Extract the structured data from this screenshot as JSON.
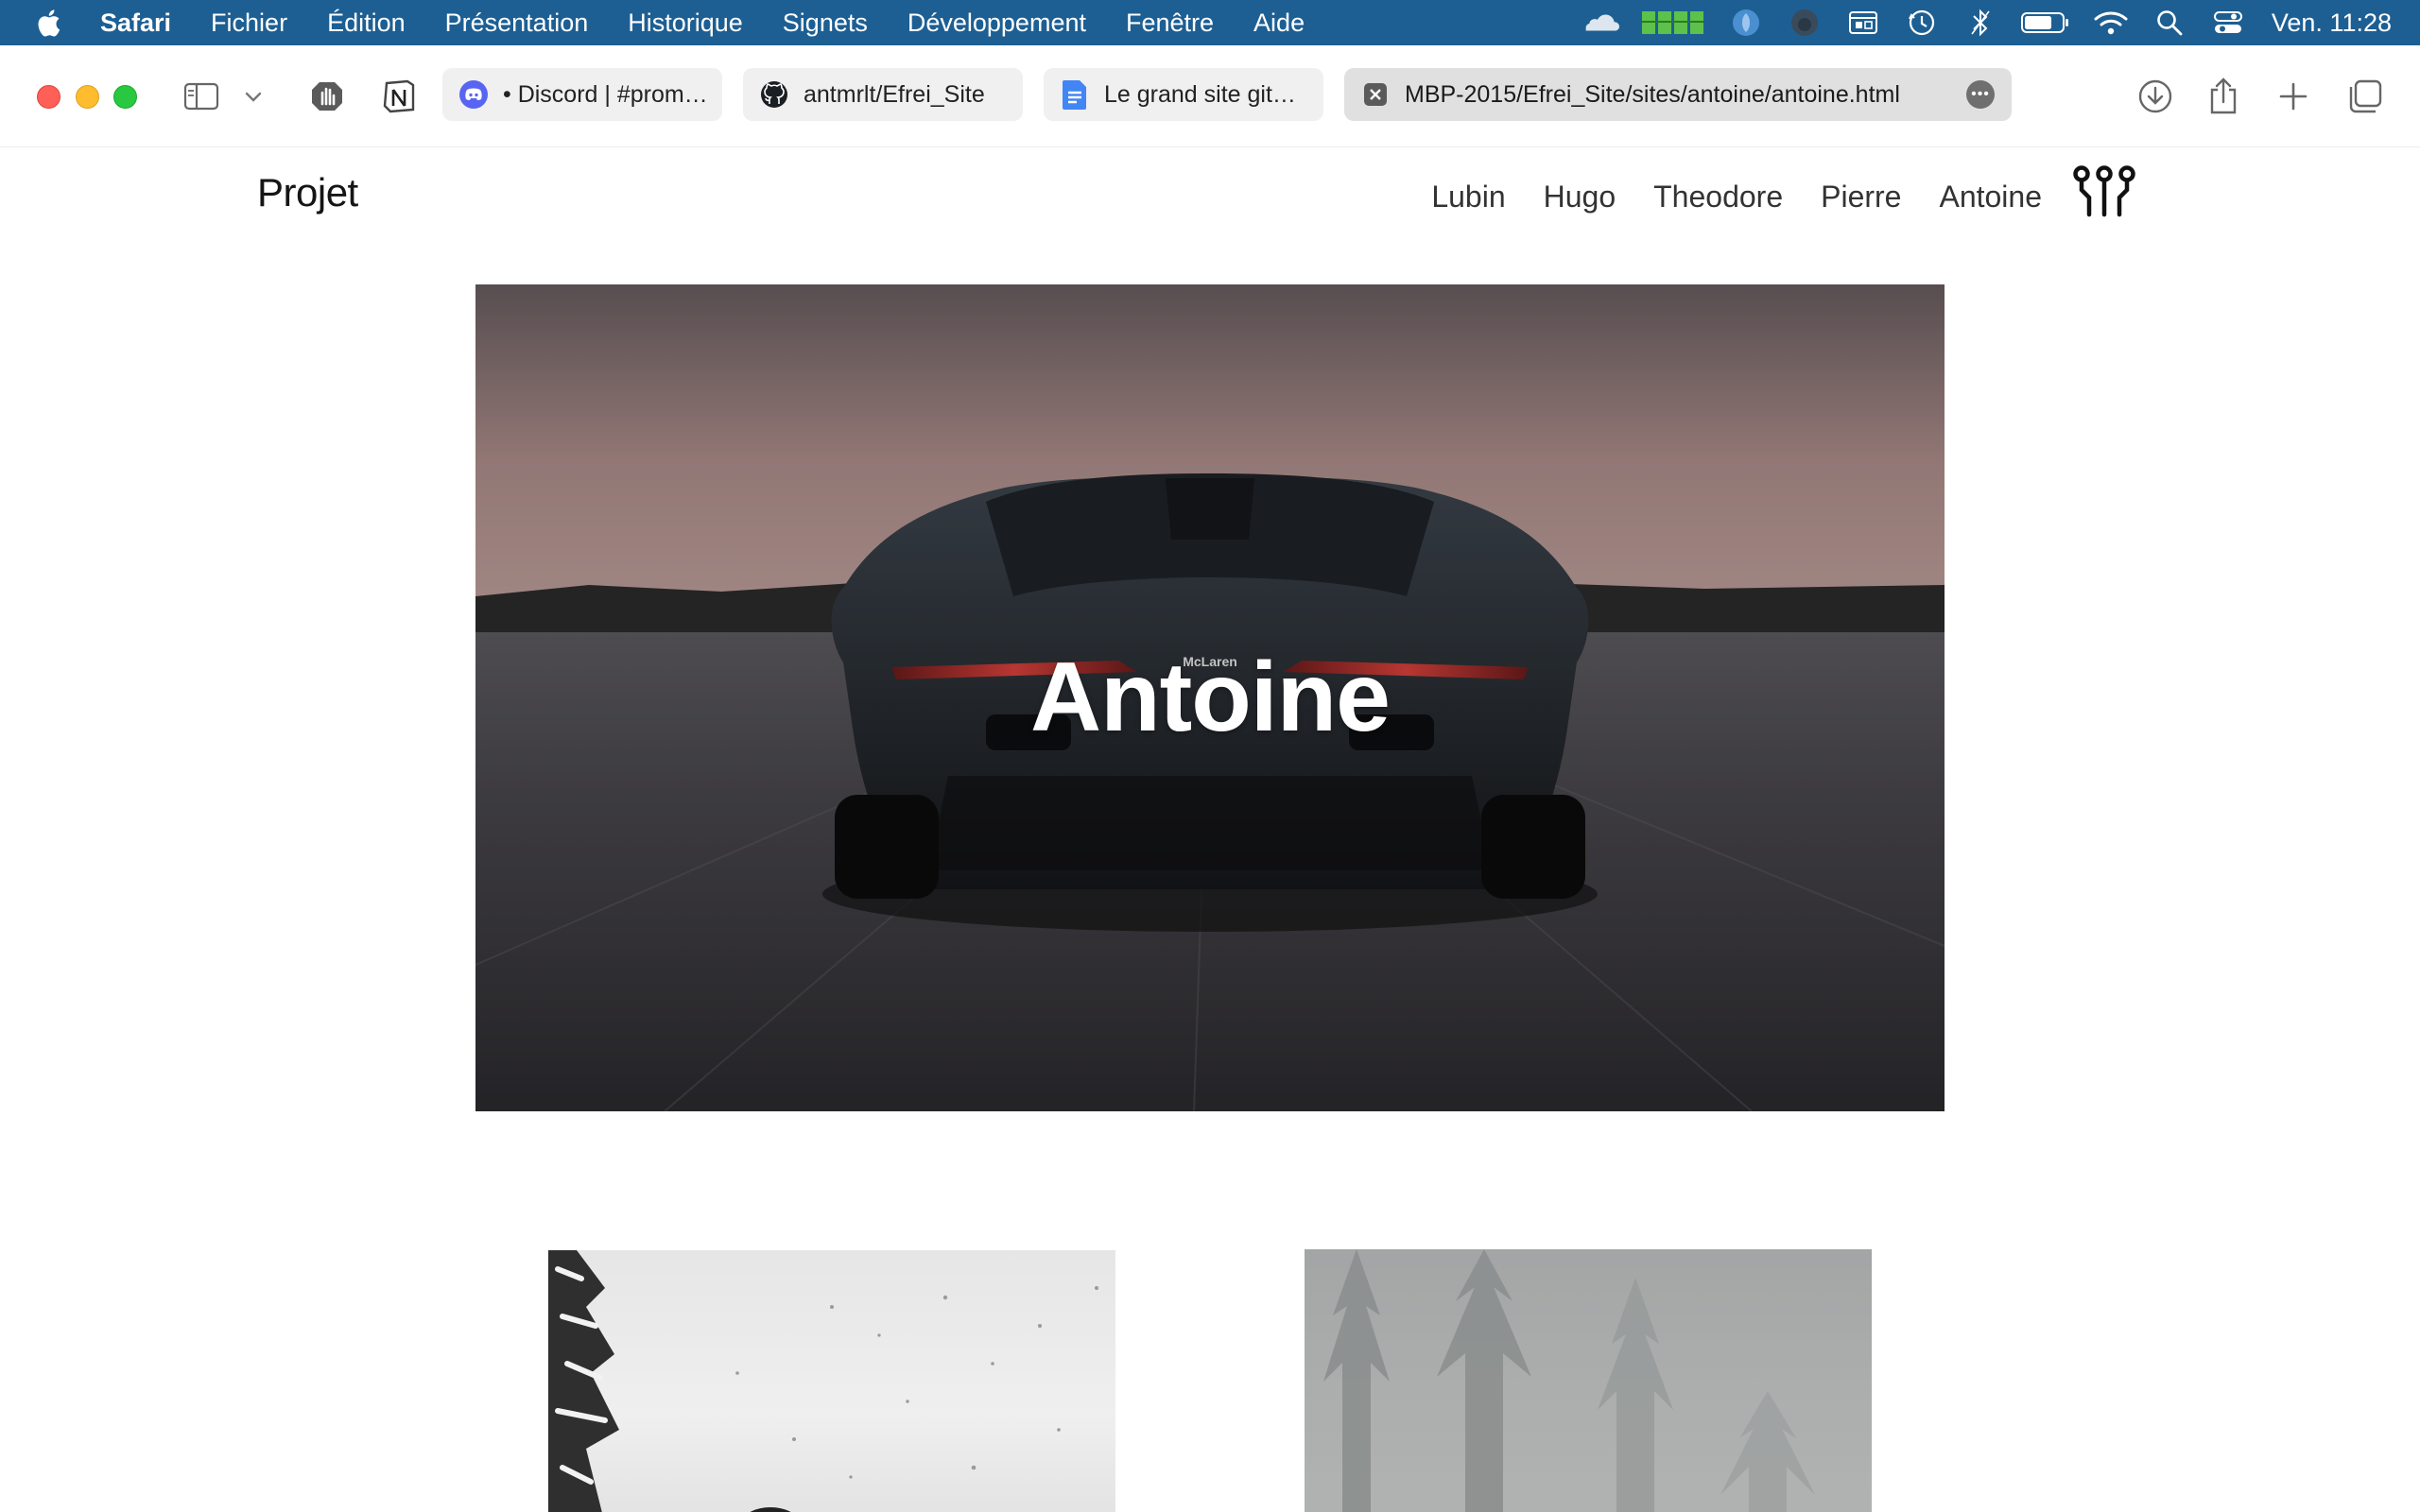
{
  "menubar": {
    "app_name": "Safari",
    "menus": [
      "Fichier",
      "Édition",
      "Présentation",
      "Historique",
      "Signets",
      "Développement",
      "Fenêtre",
      "Aide"
    ],
    "clock": "Ven. 11:28",
    "status_icons": [
      "cloud-icon",
      "grid-meter-icon",
      "shield-circle-icon",
      "github-cat-icon",
      "window-icon",
      "time-machine-icon",
      "bluetooth-icon",
      "battery-icon",
      "wifi-icon",
      "search-icon",
      "control-center-icon"
    ]
  },
  "tabs": [
    {
      "label": "• Discord | #prom…",
      "icon": "discord-icon"
    },
    {
      "label": "antmrlt/Efrei_Site",
      "icon": "github-icon"
    },
    {
      "label": "Le grand site git…",
      "icon": "google-docs-icon"
    },
    {
      "label": "MBP-2015/Efrei_Site/sites/antoine/antoine.html",
      "icon": "close-tab-icon",
      "active": true
    }
  ],
  "site": {
    "brand": "Projet",
    "nav": [
      "Lubin",
      "Hugo",
      "Theodore",
      "Pierre",
      "Antoine"
    ],
    "hero_title": "Antoine",
    "hero_badge": "McLaren"
  },
  "colors": {
    "menubar_bg": "#1d5f93",
    "discord": "#5865f2",
    "docs": "#4285f4",
    "close_red": "#fe5f57",
    "min_yellow": "#febc2e",
    "max_green": "#28c840"
  }
}
